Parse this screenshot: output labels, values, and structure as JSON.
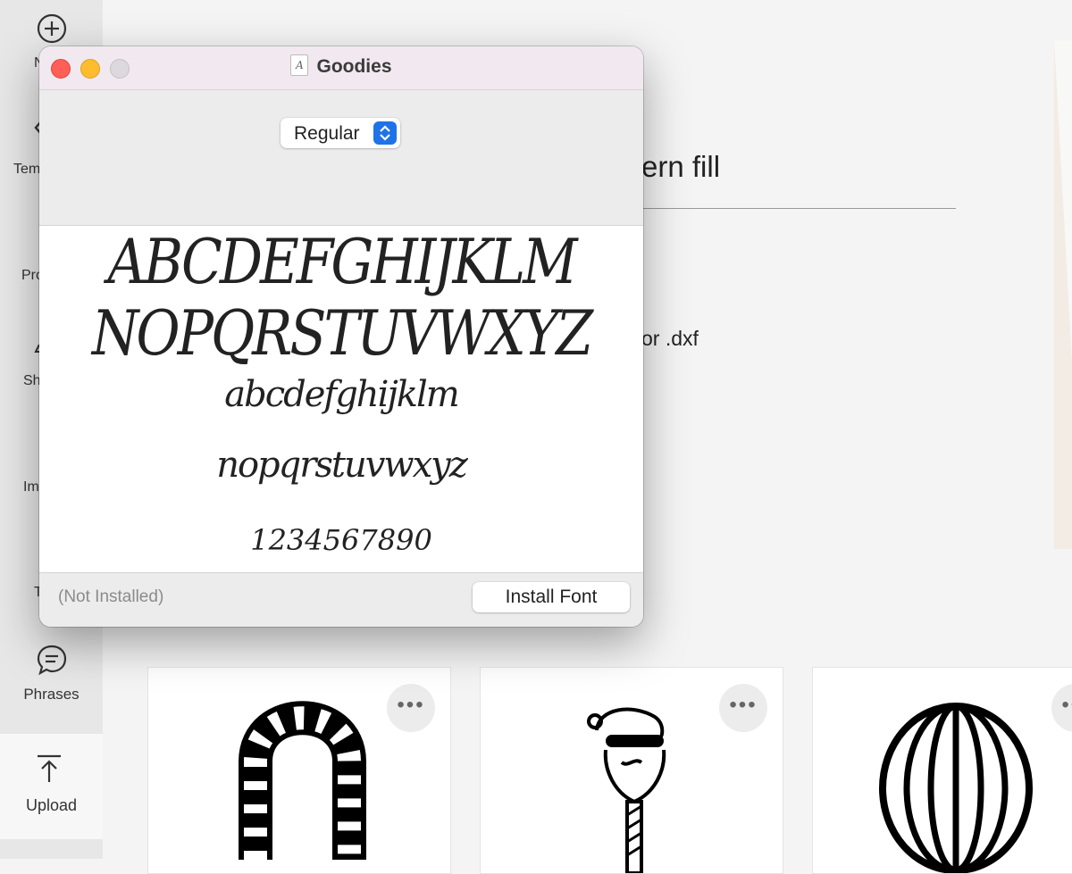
{
  "background_app": {
    "sidebar": {
      "items": [
        {
          "label": "N",
          "icon": "plus-circle-icon"
        },
        {
          "label": "Tem",
          "icon": "chevron-left-icon"
        },
        {
          "label": "Pro"
        },
        {
          "label": "Sh"
        },
        {
          "label": "Im"
        },
        {
          "label": "T"
        },
        {
          "label": "Phrases",
          "icon": "speech-bubble-icon"
        },
        {
          "label": "Upload",
          "icon": "upload-icon"
        }
      ]
    },
    "content": {
      "heading_fragment": "ern fill",
      "text_fragment": "or .dxf"
    },
    "cards": [
      {
        "art": "candy-cane",
        "more_label": "•••"
      },
      {
        "art": "santa-popsicle",
        "more_label": "•••"
      },
      {
        "art": "ornament-ball",
        "more_label": "•••"
      }
    ]
  },
  "dialog": {
    "title": "Goodies",
    "title_icon": "font-document-icon",
    "title_icon_glyph": "A",
    "style_select": {
      "selected": "Regular"
    },
    "preview": {
      "uppercase_1": "ABCDEFGHIJKLM",
      "uppercase_2": "NOPQRSTUVWXYZ",
      "lowercase_1": "abcdefghijklm",
      "lowercase_2": "nopqrstuvwxyz",
      "digits": "1234567890"
    },
    "status": "(Not Installed)",
    "install_button": "Install Font",
    "colors": {
      "close": "#ff5f57",
      "minimize": "#febc2e",
      "zoom": "#dcd8db",
      "stepper": "#1f73e8"
    }
  }
}
